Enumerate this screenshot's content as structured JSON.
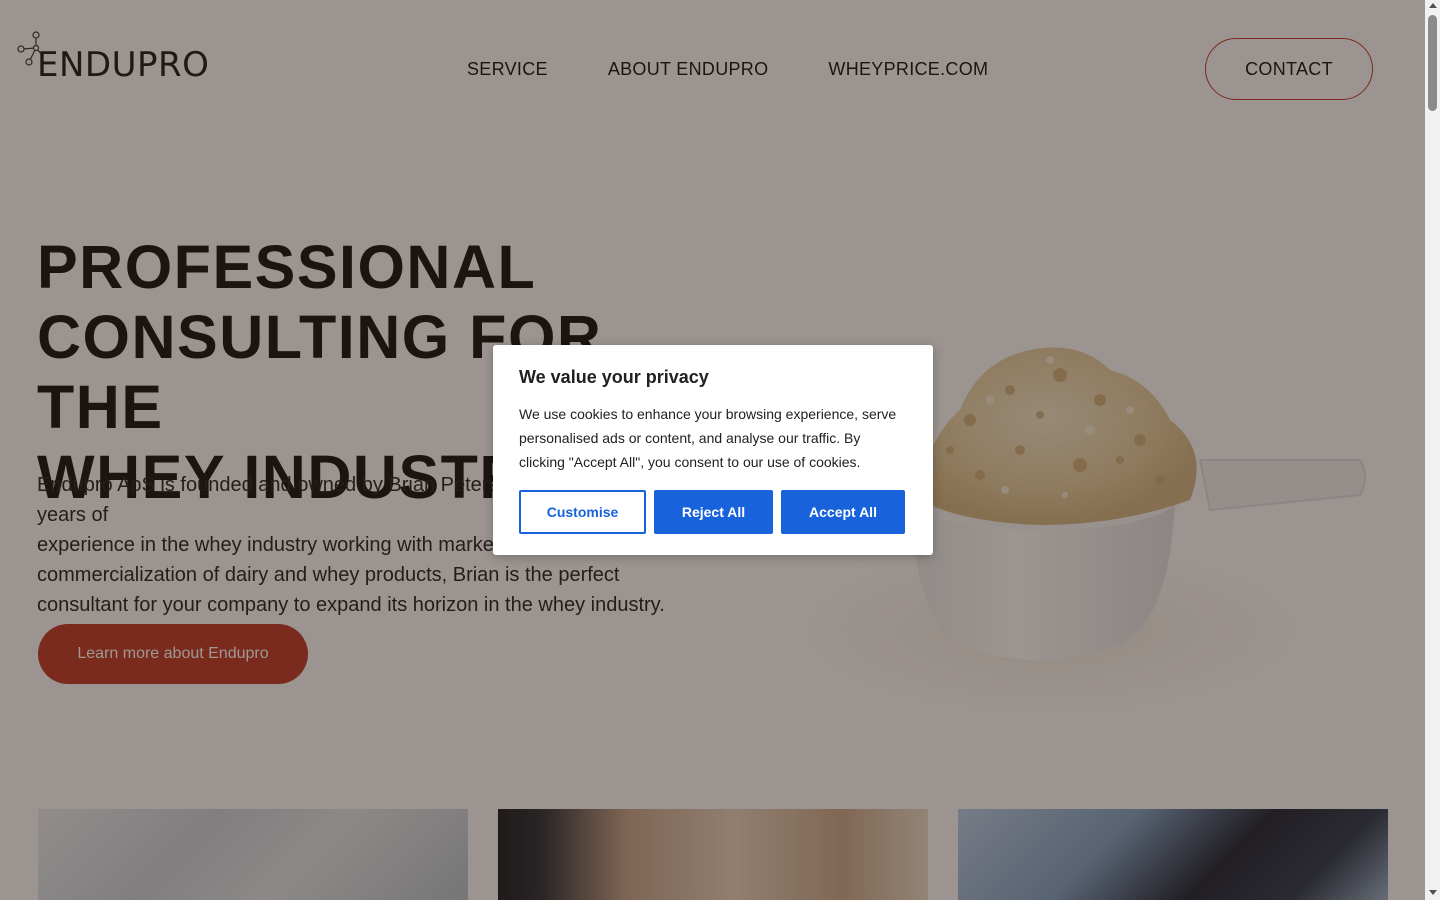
{
  "header": {
    "logo_text": "ENDUPRO",
    "nav": [
      {
        "label": "SERVICE"
      },
      {
        "label": "ABOUT ENDUPRO"
      },
      {
        "label": "WHEYPRICE.COM"
      }
    ],
    "contact_label": "CONTACT"
  },
  "hero": {
    "title_lines": [
      "PROFESSIONAL",
      "CONSULTING FOR THE",
      "WHEY INDUSTRY"
    ],
    "text_lines": [
      "Endupro ApS is founded and owned by Brian Petersen. With over 25 years of",
      "experience in the whey industry working with marketing, sales and",
      "commercialization of dairy and whey products, Brian is the perfect",
      "consultant for your company to expand its horizon in the whey industry."
    ],
    "cta_label": "Learn more about Endupro"
  },
  "cookie_banner": {
    "title": "We value your privacy",
    "text": "We use cookies to enhance your browsing experience, serve personalised ads or content, and analyse our traffic. By clicking \"Accept All\", you consent to our use of cookies.",
    "customise_label": "Customise",
    "reject_label": "Reject All",
    "accept_label": "Accept All"
  },
  "colors": {
    "accent_red": "#c0392b",
    "cookie_blue": "#1863dc",
    "overlay": "rgba(40,24,15,0.45)"
  },
  "icons": [
    "molecule-logo-icon",
    "chevron-up-icon",
    "chevron-down-icon"
  ]
}
